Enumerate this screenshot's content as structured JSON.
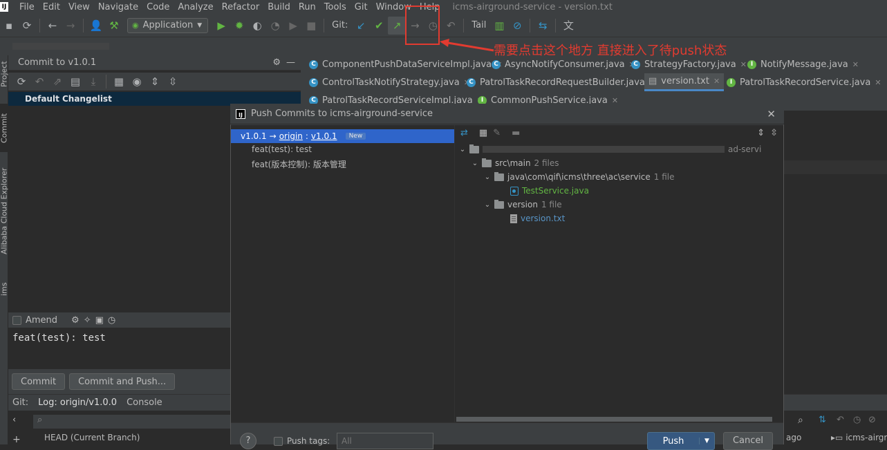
{
  "window_title": "icms-airground-service - version.txt",
  "menu": [
    "File",
    "Edit",
    "View",
    "Navigate",
    "Code",
    "Analyze",
    "Refactor",
    "Build",
    "Run",
    "Tools",
    "Git",
    "Window",
    "Help"
  ],
  "toolbar": {
    "run_config": "Application",
    "git_label": "Git:",
    "tail_label": "Tail"
  },
  "annotation": "需要点击这个地方 直接进入了待push状态",
  "commit_panel": {
    "title": "Commit to v1.0.1",
    "changelist": "Default Changelist",
    "amend_label": "Amend",
    "message": "feat(test): test",
    "commit_button": "Commit",
    "commit_push_button": "Commit and Push..."
  },
  "left_tabs": [
    "Project",
    "Commit",
    "Alibaba Cloud Explorer",
    "ims"
  ],
  "editor_tabs": [
    {
      "label": "ComponentPushDataServiceImpl.java",
      "icon": "class-icon"
    },
    {
      "label": "AsyncNotifyConsumer.java",
      "icon": "class-icon"
    },
    {
      "label": "StrategyFactory.java",
      "icon": "class-icon"
    },
    {
      "label": "NotifyMessage.java",
      "icon": "interface-icon"
    },
    {
      "label": "ControlTaskNotifyStrategy.java",
      "icon": "class-icon"
    },
    {
      "label": "PatrolTaskRecordRequestBuilder.java",
      "icon": "class-icon"
    },
    {
      "label": "version.txt",
      "icon": "text-file-icon"
    },
    {
      "label": "PatrolTaskRecordService.java",
      "icon": "interface-icon"
    },
    {
      "label": "PatrolTaskRecordServiceImpl.java",
      "icon": "class-icon"
    },
    {
      "label": "CommonPushService.java",
      "icon": "interface-icon"
    }
  ],
  "dialog": {
    "title": "Push Commits to icms-airground-service",
    "branch": {
      "local": "v1.0.1",
      "arrow": "→",
      "remote": "origin",
      "sep": ":",
      "remote_branch": "v1.0.1",
      "badge": "New"
    },
    "commits": [
      "feat(test): test",
      "feat(版本控制): 版本管理"
    ],
    "tree": {
      "root_suffix": "ad-servi",
      "src_main": {
        "name": "src\\main",
        "count": "2 files"
      },
      "java_pkg": {
        "name": "java\\com\\qif\\icms\\three\\ac\\service",
        "count": "1 file"
      },
      "java_file": "TestService.java",
      "version_dir": {
        "name": "version",
        "count": "1 file"
      },
      "version_file": "version.txt"
    },
    "push_tags_label": "Push tags:",
    "push_tags_value": "All",
    "push_button": "Push",
    "cancel_button": "Cancel",
    "help": "?"
  },
  "bottom": {
    "tabs": [
      "Git:",
      "Log: origin/v1.0.0",
      "Console"
    ],
    "branch_item": "HEAD (Current Branch)",
    "right_text": "ago",
    "right_repo": "icms-airgr"
  },
  "colors": {
    "accent": "#2f65ca",
    "annotation": "#e23b30",
    "push": "#365880"
  }
}
